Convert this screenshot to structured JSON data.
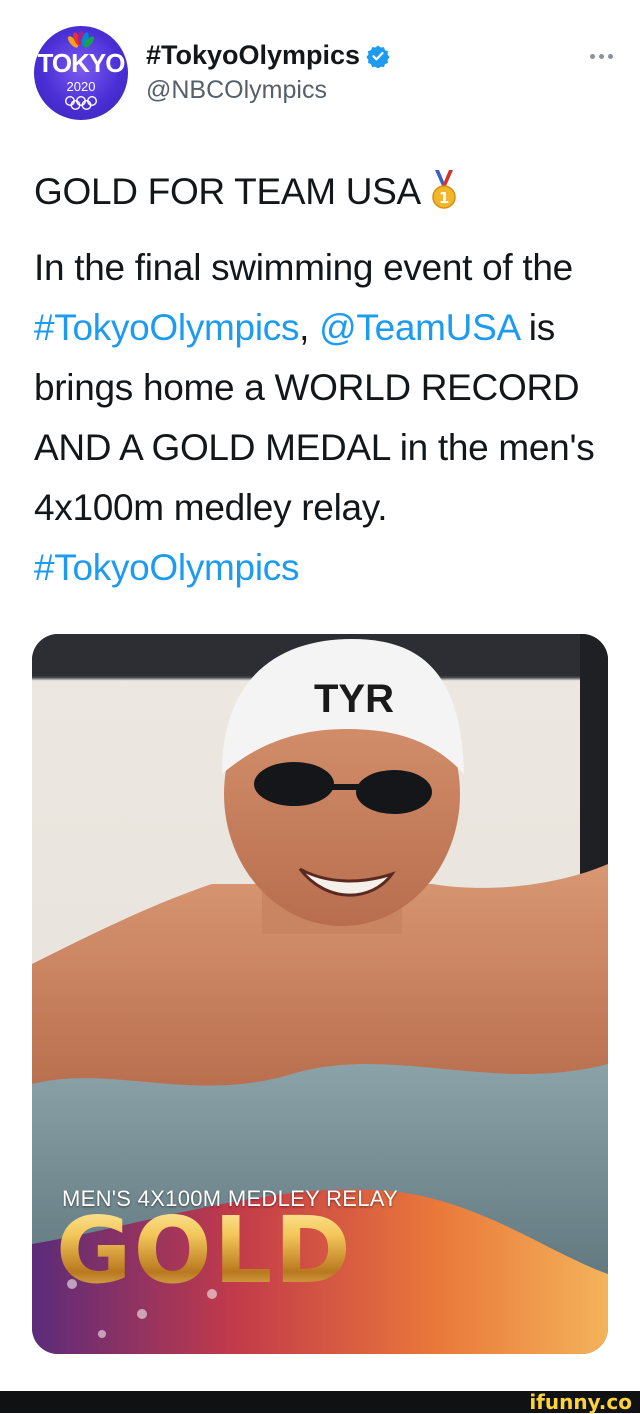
{
  "tweet": {
    "avatar": {
      "word": "TOKYO",
      "year": "2020"
    },
    "display_name": "#TokyoOlympics",
    "handle": "@NBCOlympics",
    "headline": "GOLD FOR TEAM USA",
    "body_segments": [
      {
        "text": "In the final swimming event of the ",
        "link": false
      },
      {
        "text": "#TokyoOlympics",
        "link": true
      },
      {
        "text": ", ",
        "link": false
      },
      {
        "text": "@TeamUSA",
        "link": true
      },
      {
        "text": " is brings home a WORLD RECORD AND A GOLD MEDAL in the men's 4x100m medley relay. ",
        "link": false
      },
      {
        "text": "#TokyoOlympics",
        "link": true
      }
    ],
    "media": {
      "cap_brand": "TYR",
      "caption": "MEN'S 4X100M MEDLEY RELAY",
      "big_word": "GOLD"
    }
  },
  "watermark": "ifunny.co",
  "colors": {
    "link": "#1d9bf0",
    "verified": "#1d9bf0",
    "gold": "#f1c24c"
  }
}
